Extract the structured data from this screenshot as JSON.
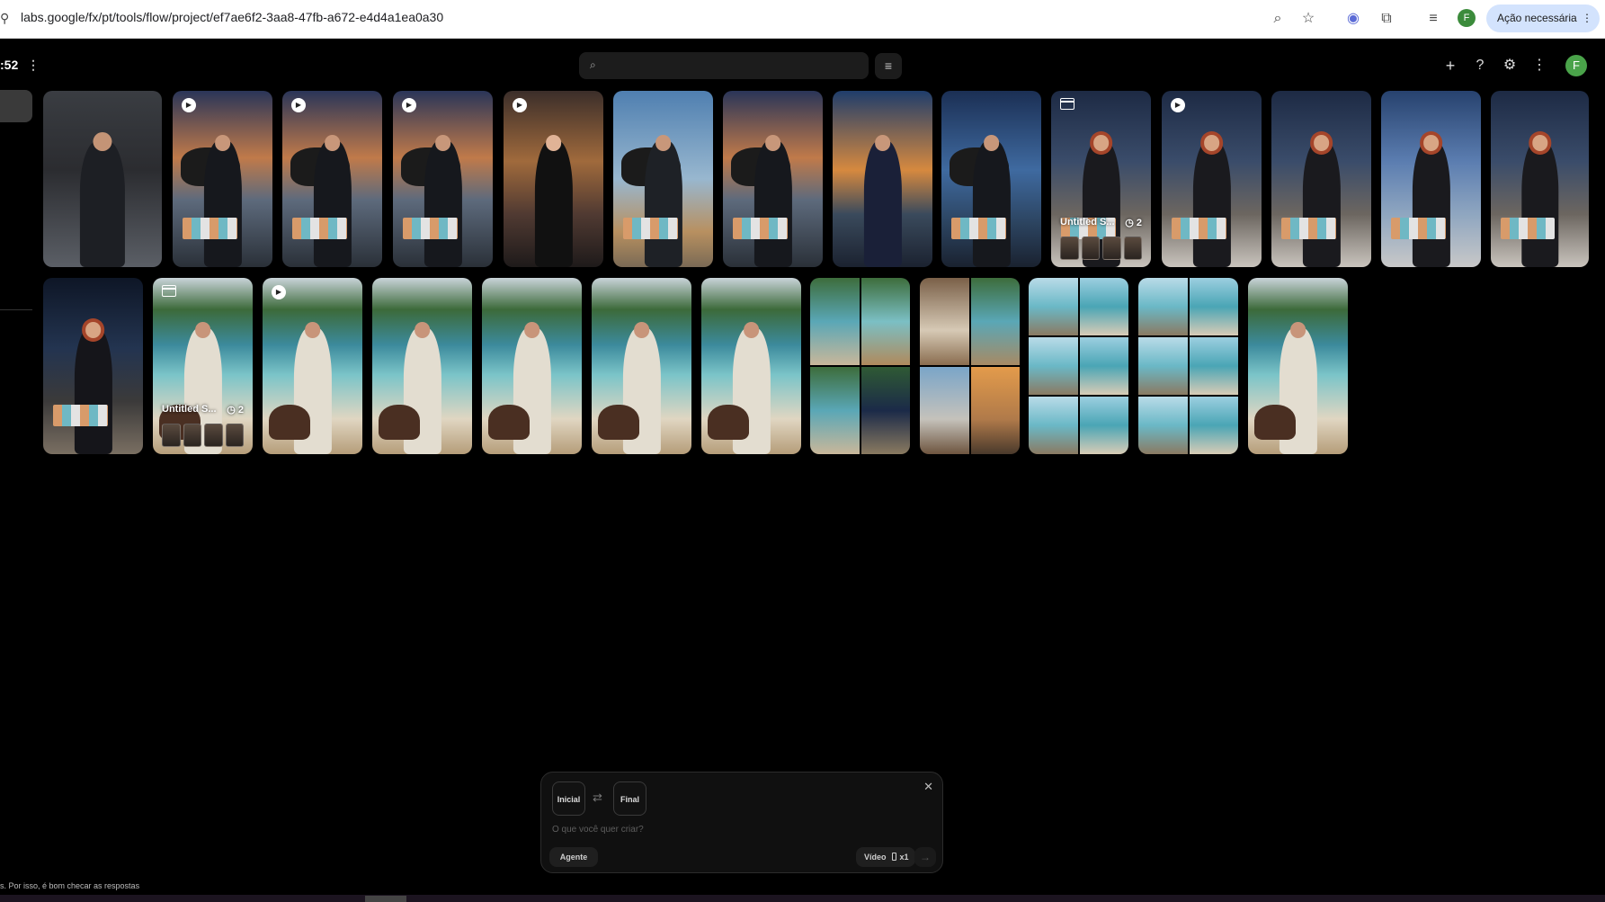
{
  "browser": {
    "url": "labs.google/fx/pt/tools/flow/project/ef7ae6f2-3aa8-47fb-a672-e4d4a1ea0a30",
    "profile_initial": "F",
    "action_label": "Ação necessária",
    "icons": [
      "zoom-icon",
      "star-icon",
      "cast-icon",
      "extensions-icon",
      "media-icon"
    ]
  },
  "app": {
    "project_label": ":52",
    "search_placeholder": "",
    "avatar_initial": "F",
    "toolbar_icons": [
      "add-icon",
      "help-icon",
      "settings-icon",
      "more-icon"
    ]
  },
  "gallery": {
    "row1": [
      {
        "type": "image",
        "scene": "garage"
      },
      {
        "type": "video",
        "scene": "helipad"
      },
      {
        "type": "video",
        "scene": "helipad"
      },
      {
        "type": "video",
        "scene": "helipad"
      },
      {
        "type": "video",
        "scene": "cartoon-woman"
      },
      {
        "type": "image",
        "scene": "helipad-day"
      },
      {
        "type": "image",
        "scene": "helipad"
      },
      {
        "type": "image",
        "scene": "sunset-cash"
      },
      {
        "type": "image",
        "scene": "helipad-blue"
      },
      {
        "type": "collection",
        "scene": "redhead-balcony",
        "title": "Untitled S...",
        "count": "2"
      },
      {
        "type": "video",
        "scene": "redhead-balcony"
      },
      {
        "type": "image",
        "scene": "redhead-balcony"
      },
      {
        "type": "image",
        "scene": "redhead-window"
      },
      {
        "type": "image",
        "scene": "redhead-balcony"
      }
    ],
    "row2": [
      {
        "type": "image",
        "scene": "redhead-night"
      },
      {
        "type": "collection",
        "scene": "beach-yacht",
        "title": "Untitled S...",
        "count": "2"
      },
      {
        "type": "video",
        "scene": "beach-yacht"
      },
      {
        "type": "image",
        "scene": "beach-yacht"
      },
      {
        "type": "image",
        "scene": "beach-yacht"
      },
      {
        "type": "image",
        "scene": "beach-yacht"
      },
      {
        "type": "image",
        "scene": "beach-yacht"
      },
      {
        "type": "image",
        "scene": "grid4"
      },
      {
        "type": "image",
        "scene": "grid-deck"
      },
      {
        "type": "image",
        "scene": "grid6"
      },
      {
        "type": "image",
        "scene": "grid-pier"
      },
      {
        "type": "image",
        "scene": "beach-yacht"
      }
    ]
  },
  "composer": {
    "start_label": "Inicial",
    "end_label": "Final",
    "placeholder": "O que você quer criar?",
    "agent_label": "Agente",
    "mode_label": "Vídeo",
    "count_label": "x1"
  },
  "footer": {
    "disclaimer": "s. Por isso, é bom checar as respostas"
  }
}
